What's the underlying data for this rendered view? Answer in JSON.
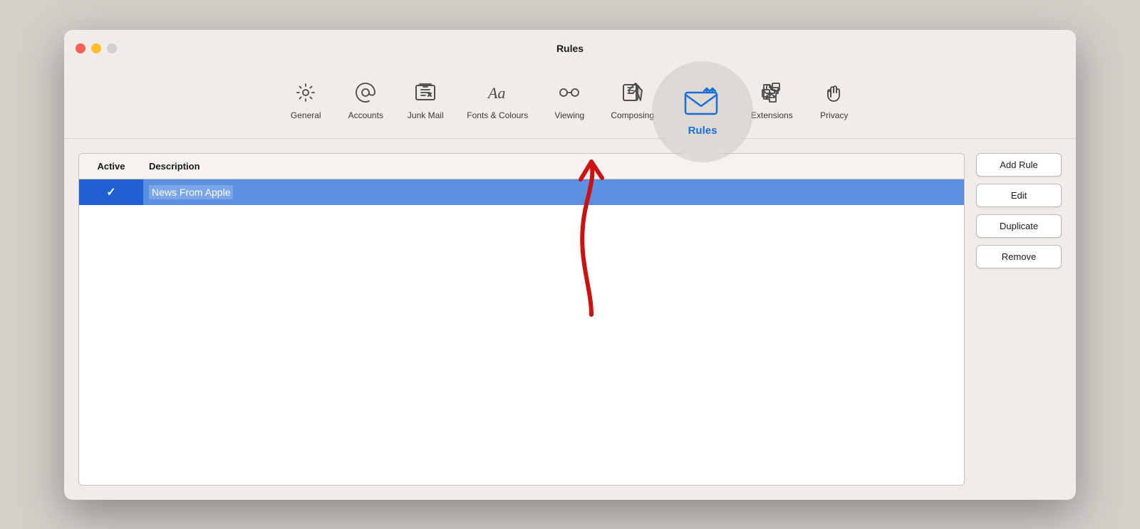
{
  "window": {
    "title": "Rules",
    "controls": {
      "close": "close",
      "minimize": "minimize",
      "maximize": "maximize"
    }
  },
  "toolbar": {
    "items": [
      {
        "id": "general",
        "label": "General",
        "icon": "gear"
      },
      {
        "id": "accounts",
        "label": "Accounts",
        "icon": "at"
      },
      {
        "id": "junk-mail",
        "label": "Junk Mail",
        "icon": "junk"
      },
      {
        "id": "fonts-colours",
        "label": "Fonts & Colours",
        "icon": "fonts"
      },
      {
        "id": "viewing",
        "label": "Viewing",
        "icon": "viewing"
      },
      {
        "id": "composing",
        "label": "Composing",
        "icon": "composing"
      },
      {
        "id": "rules",
        "label": "Rules",
        "icon": "rules",
        "active": true
      },
      {
        "id": "extensions",
        "label": "Extensions",
        "icon": "extensions"
      },
      {
        "id": "privacy",
        "label": "Privacy",
        "icon": "privacy"
      }
    ]
  },
  "table": {
    "columns": {
      "active": "Active",
      "description": "Description"
    },
    "rows": [
      {
        "active": true,
        "description": "News From Apple"
      }
    ]
  },
  "buttons": {
    "add_rule": "Add Rule",
    "edit": "Edit",
    "duplicate": "Duplicate",
    "remove": "Remove"
  }
}
